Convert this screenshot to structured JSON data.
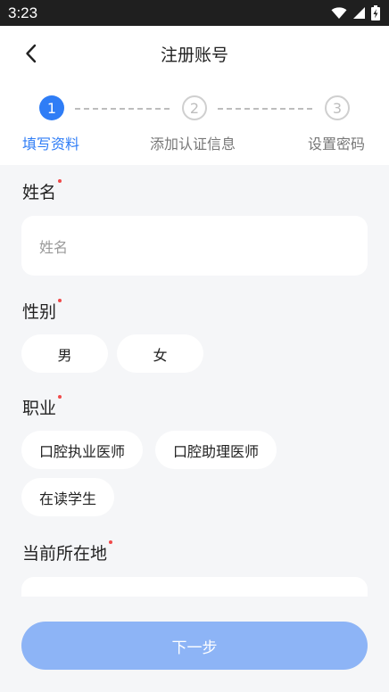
{
  "status_bar": {
    "time": "3:23",
    "icons": [
      "wifi-icon",
      "signal-icon",
      "battery-icon"
    ]
  },
  "nav": {
    "title": "注册账号",
    "back_icon": "chevron-left-icon"
  },
  "steps": [
    {
      "number": "1",
      "label": "填写资料",
      "active": true
    },
    {
      "number": "2",
      "label": "添加认证信息",
      "active": false
    },
    {
      "number": "3",
      "label": "设置密码",
      "active": false
    }
  ],
  "form": {
    "name": {
      "label": "姓名",
      "placeholder": "姓名",
      "value": ""
    },
    "gender": {
      "label": "性别",
      "options": [
        "男",
        "女"
      ]
    },
    "occupation": {
      "label": "职业",
      "options": [
        "口腔执业医师",
        "口腔助理医师",
        "在读学生"
      ]
    },
    "location": {
      "label": "当前所在地"
    }
  },
  "next_button": {
    "label": "下一步"
  },
  "colors": {
    "accent": "#2f7df6",
    "button_disabled": "#8db4f6",
    "required": "#f04a4a"
  }
}
